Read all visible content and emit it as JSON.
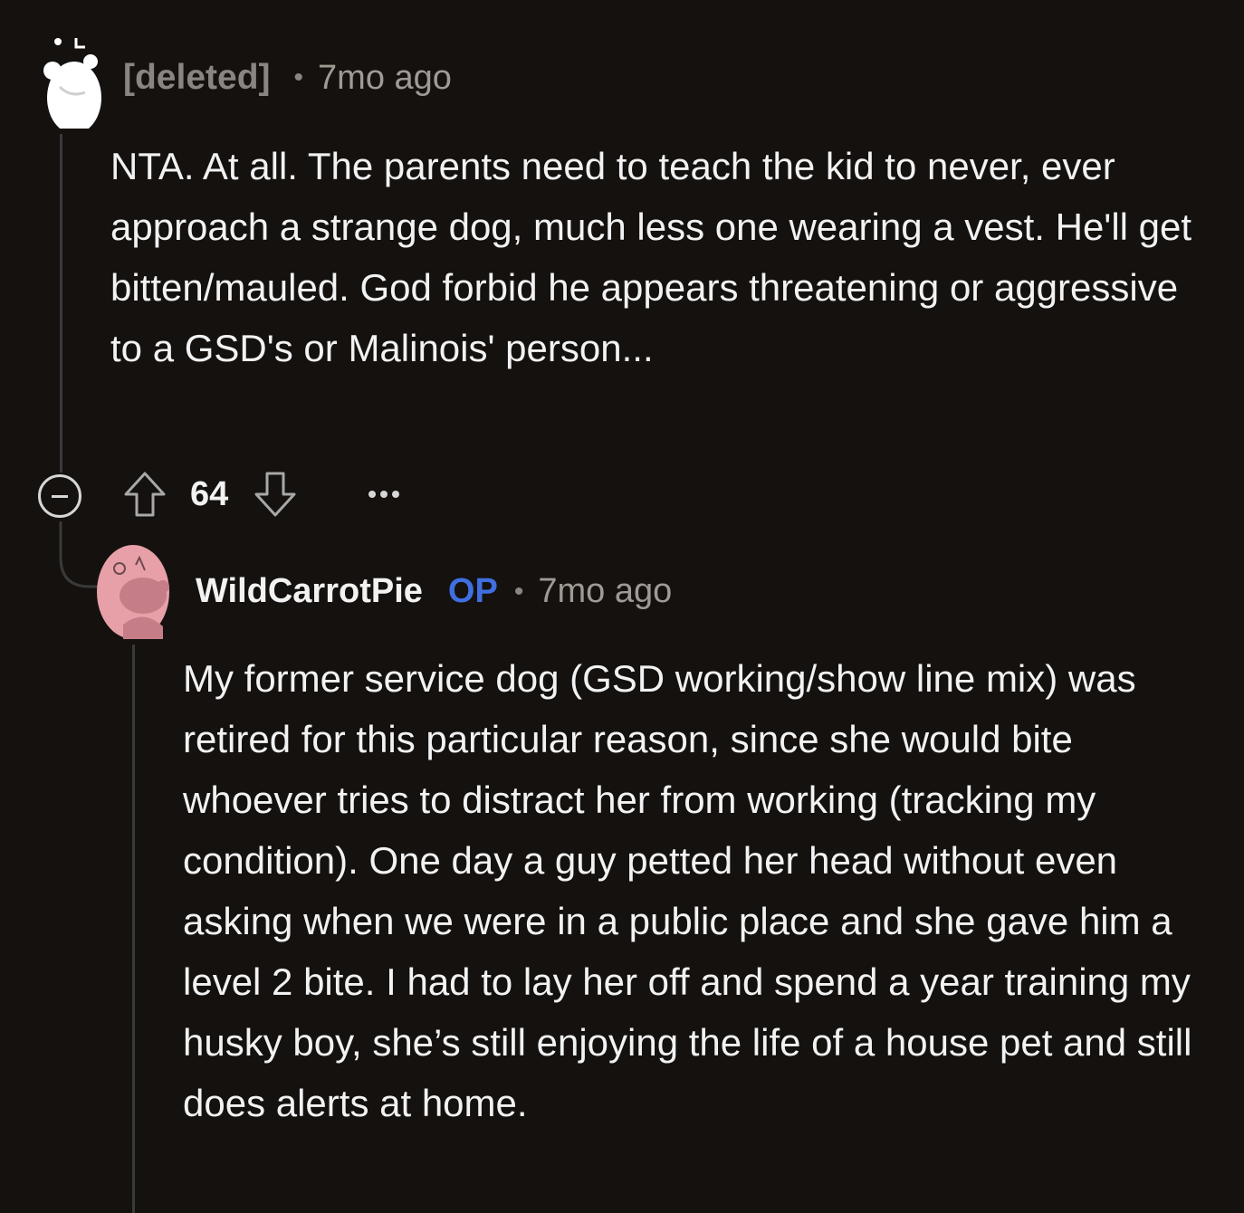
{
  "comments": [
    {
      "author": "[deleted]",
      "time": "7mo ago",
      "body": "NTA. At all. The parents need to teach the kid to never, ever approach a strange dog, much less one wearing a vest. He'll get bitten/mauled. God forbid he appears threatening or aggressive to a GSD's or Malinois' person...",
      "score": "64",
      "avatar_icon": "snoo-avatar-icon"
    },
    {
      "author": "WildCarrotPie",
      "badge": "OP",
      "time": "7mo ago",
      "body": "My former service dog (GSD working/show line mix) was retired for this particular reason, since she would bite whoever tries to distract her from working (tracking my condition). One day a guy petted her head without even asking when we were in a public place and she gave him a level 2 bite. I had to lay her off and spend a year training my husky boy, she’s still enjoying the life of a house pet and still does alerts at home.",
      "avatar_icon": "snoo-avatar-icon",
      "avatar_color": "#e8a0a8"
    }
  ],
  "colors": {
    "background": "#14110f",
    "op_badge": "#3f6fe0",
    "muted_text": "#8a8581"
  }
}
